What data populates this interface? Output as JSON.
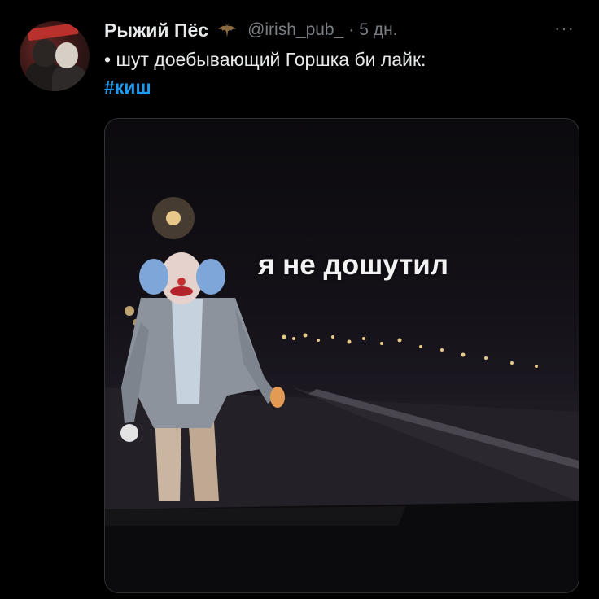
{
  "tweet": {
    "display_name": "Рыжий Пёс",
    "handle": "@irish_pub_",
    "separator": "·",
    "time": "5 дн.",
    "text": "• шут доебывающий Горшка би лайк:",
    "hashtag": "#киш",
    "more_label": "···",
    "badge_icon": "bat-icon",
    "avatar_icon": "avatar-photo"
  },
  "media": {
    "caption": "я не дошутил",
    "icon": "clown-photo"
  },
  "colors": {
    "background": "#000000",
    "text": "#e7e9ea",
    "secondary": "#7a7f84",
    "link": "#1d9bf0"
  }
}
